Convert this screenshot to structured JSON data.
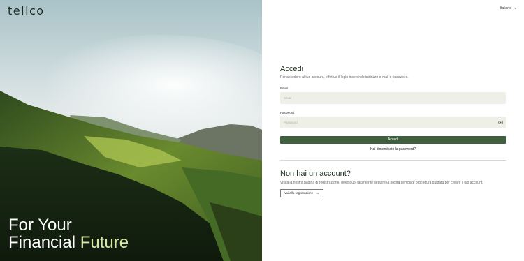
{
  "brand": {
    "logo": "tellco"
  },
  "hero": {
    "tagline_line1": "For Your",
    "tagline_line2_prefix": "Financial",
    "tagline_line2_accent": "Future"
  },
  "language": {
    "selected": "Italiano"
  },
  "login": {
    "title": "Accedi",
    "subtitle": "Per accedere al tuo account, effettua il login inserendo indirizzo e-mail e password.",
    "email_label": "Email",
    "email_placeholder": "Email",
    "password_label": "Password",
    "password_placeholder": "Password",
    "submit_label": "Accedi",
    "forgot_label": "Hai dimenticato la password?"
  },
  "register": {
    "title": "Non hai un account?",
    "subtitle": "Visita la nostra pagina di registrazione, dove puoi facilmente seguire la nostra semplice procedura guidata per creare il tuo account.",
    "button_label": "Vai alla registrazione"
  },
  "colors": {
    "primary": "#3f5f3e",
    "accent_text": "#d9e8a8",
    "input_bg": "#eef0e8"
  }
}
